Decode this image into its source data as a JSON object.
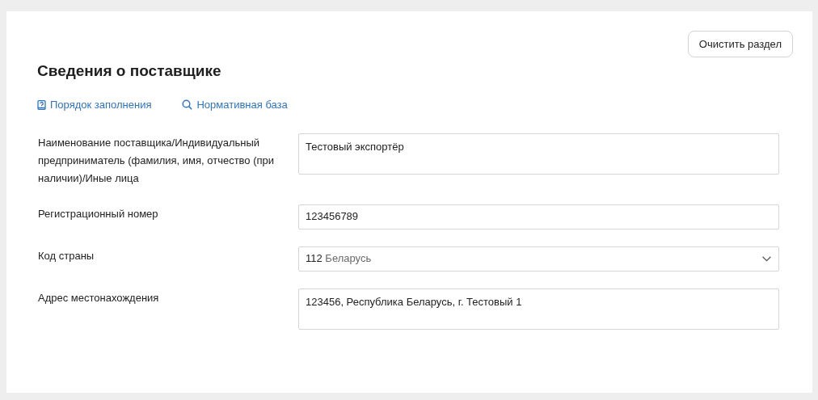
{
  "clear_button": "Очистить раздел",
  "title": "Сведения о поставщике",
  "links": [
    {
      "kind": "guide",
      "label": "Порядок заполнения"
    },
    {
      "kind": "search",
      "label": "Нормативная база"
    }
  ],
  "fields": [
    {
      "kind": "textarea",
      "label": "Наименование поставщика/Индивидуальный предприниматель (фамилия, имя, отчество (при наличии)/Иные лица",
      "value": "Тестовый экспортёр"
    },
    {
      "kind": "input",
      "label": "Регистрационный номер",
      "value": "123456789"
    },
    {
      "kind": "select",
      "label": "Код страны",
      "code": "112",
      "name": "Беларусь"
    },
    {
      "kind": "textarea",
      "label": "Адрес местонахождения",
      "value": "123456, Республика Беларусь, г. Тестовый 1"
    }
  ]
}
